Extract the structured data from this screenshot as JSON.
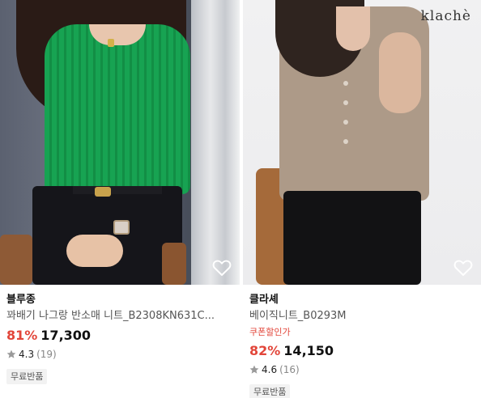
{
  "products": [
    {
      "brand": "블루종",
      "name": "꽈배기 나그랑 반소매 니트_B2308KN631C...",
      "coupon": "",
      "discount": "81%",
      "price": "17,300",
      "rating": "4.3",
      "review_count": "(19)",
      "badge": "무료반품",
      "image_watermark": "",
      "icons": {
        "wishlist": "heart-outline-icon",
        "star": "star-icon"
      }
    },
    {
      "brand": "클라셰",
      "name": "베이직니트_B0293M",
      "coupon": "쿠폰할인가",
      "discount": "82%",
      "price": "14,150",
      "rating": "4.6",
      "review_count": "(16)",
      "badge": "무료반품",
      "image_watermark": "klachè",
      "icons": {
        "wishlist": "heart-outline-icon",
        "star": "star-icon"
      }
    }
  ],
  "colors": {
    "discount": "#e2463a",
    "star": "#9a9a9a",
    "badge_bg": "#f2f2f2"
  }
}
